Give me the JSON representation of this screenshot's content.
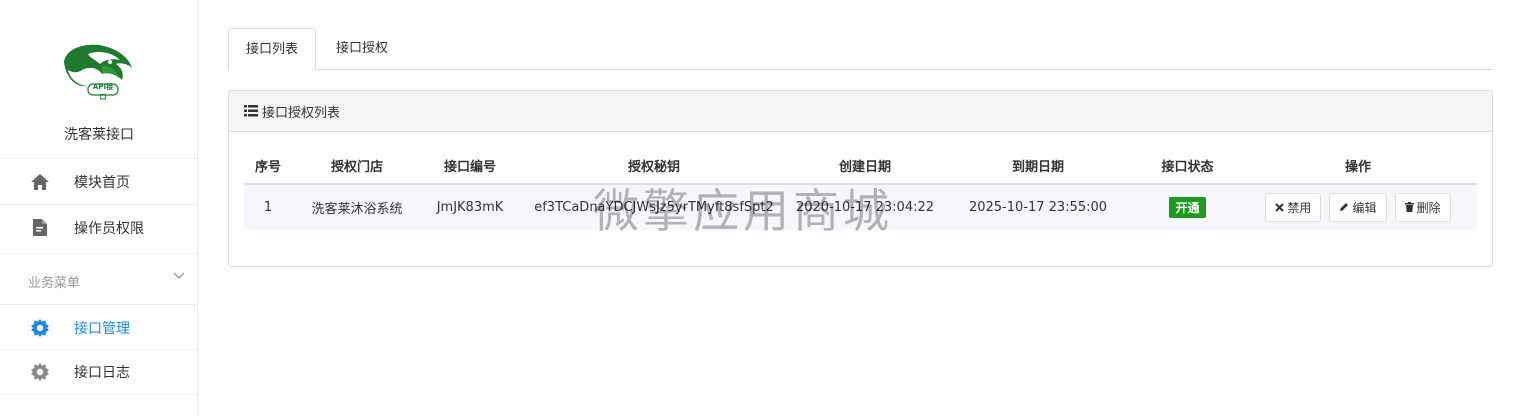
{
  "sidebar": {
    "logo_text": "API接口",
    "brand": "洗客莱接口",
    "items": [
      {
        "label": "模块首页",
        "icon": "home-icon"
      },
      {
        "label": "操作员权限",
        "icon": "document-edit-icon"
      }
    ],
    "section": {
      "label": "业务菜单"
    },
    "section_items": [
      {
        "label": "接口管理",
        "icon": "gear-icon",
        "active": true
      },
      {
        "label": "接口日志",
        "icon": "gear-icon",
        "active": false
      }
    ]
  },
  "tabs": [
    {
      "label": "接口列表",
      "active": true
    },
    {
      "label": "接口授权",
      "active": false
    }
  ],
  "panel": {
    "title": "接口授权列表",
    "columns": [
      "序号",
      "授权门店",
      "接口编号",
      "授权秘钥",
      "创建日期",
      "到期日期",
      "接口状态",
      "操作"
    ],
    "rows": [
      {
        "index": "1",
        "store": "洗客莱沐浴系统",
        "code": "JmJK83mK",
        "secret": "ef3TCaDnaYDCJWsJz5yrTMyft8sfSpt2",
        "created": "2020-10-17 23:04:22",
        "expires": "2025-10-17 23:55:00",
        "status": "开通",
        "actions": {
          "disable": "禁用",
          "edit": "编辑",
          "delete": "删除"
        }
      }
    ]
  },
  "watermark": "微擎应用商城",
  "colors": {
    "accent": "#1e88e5",
    "status_green": "#1e9a1e",
    "logo_green": "#1f7a2e"
  }
}
